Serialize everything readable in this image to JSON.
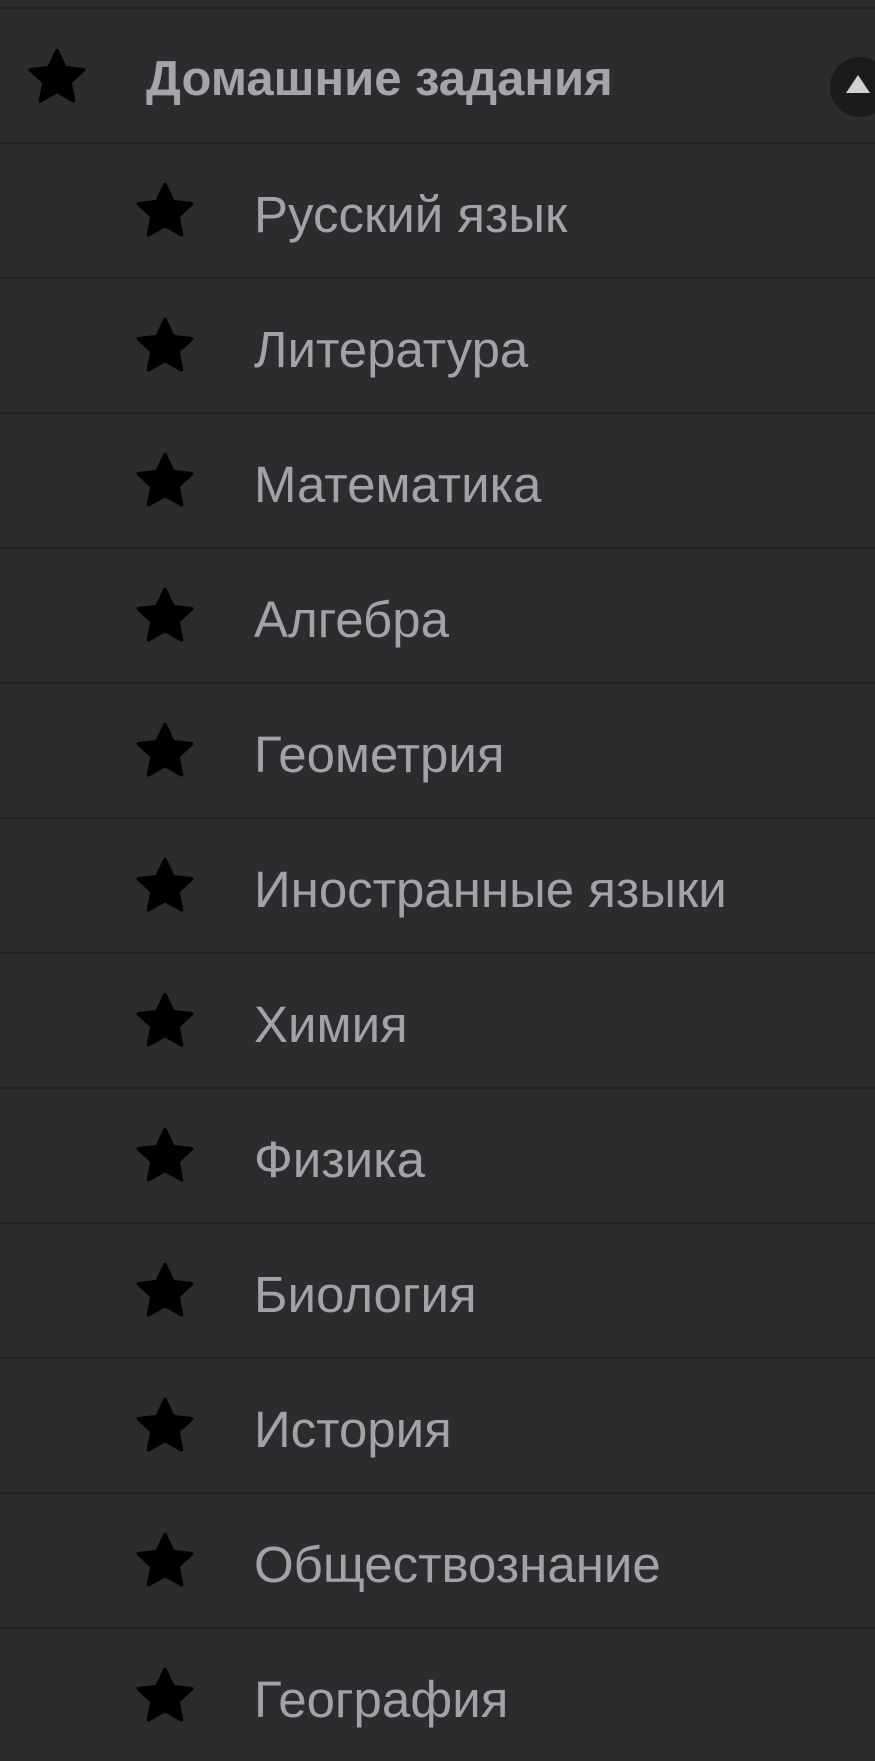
{
  "header": {
    "title": "Домашние задания",
    "icon": "star-icon",
    "collapse_icon": "chevron-up-icon"
  },
  "items": [
    {
      "label": "Русский язык",
      "icon": "star-icon"
    },
    {
      "label": "Литература",
      "icon": "star-icon"
    },
    {
      "label": "Математика",
      "icon": "star-icon"
    },
    {
      "label": "Алгебра",
      "icon": "star-icon"
    },
    {
      "label": "Геометрия",
      "icon": "star-icon"
    },
    {
      "label": "Иностранные языки",
      "icon": "star-icon"
    },
    {
      "label": "Химия",
      "icon": "star-icon"
    },
    {
      "label": "Физика",
      "icon": "star-icon"
    },
    {
      "label": "Биология",
      "icon": "star-icon"
    },
    {
      "label": "История",
      "icon": "star-icon"
    },
    {
      "label": "Обществознание",
      "icon": "star-icon"
    },
    {
      "label": "География",
      "icon": "star-icon"
    }
  ],
  "colors": {
    "background": "#2c2c2f",
    "divider": "#222225",
    "text": "#a2a2a7",
    "icon": "#000000"
  }
}
